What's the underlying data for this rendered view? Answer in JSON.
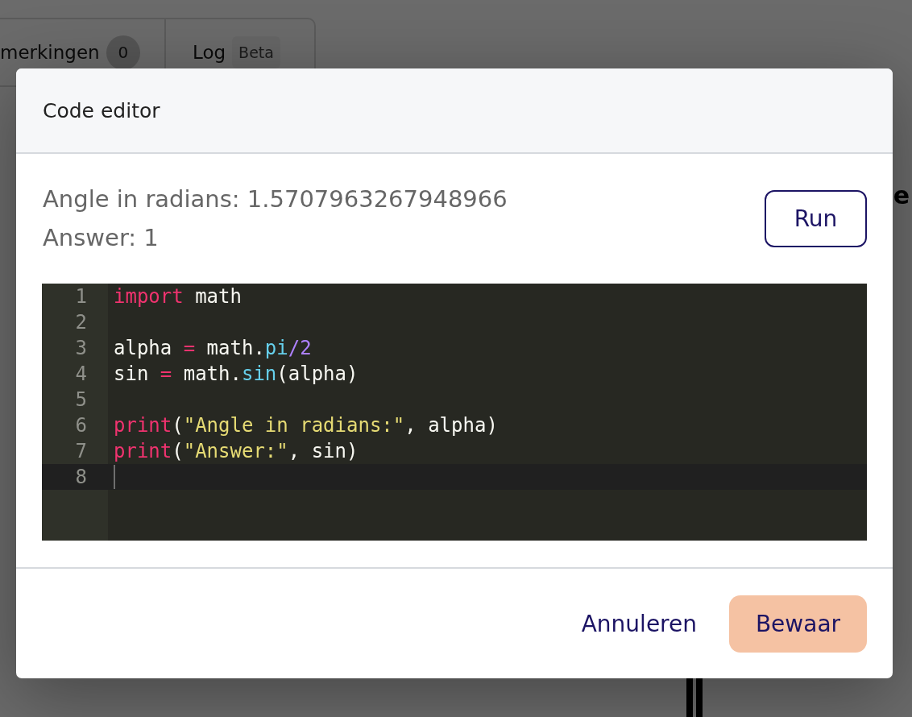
{
  "background_page": {
    "tabs": [
      {
        "label": "merkingen",
        "badge": "0",
        "kind": "count"
      },
      {
        "label": "Log",
        "badge": "Beta",
        "kind": "tag"
      }
    ],
    "heading_fragment": "e"
  },
  "dialog": {
    "title": "Code editor",
    "output": [
      "Angle in radians: 1.5707963267948966",
      "Answer: 1"
    ],
    "run_button": "Run",
    "editor": {
      "lines": [
        {
          "number": "1",
          "active": false,
          "tokens": [
            {
              "text": "import",
              "kind": "keyword"
            },
            {
              "text": " math",
              "kind": "plain"
            }
          ]
        },
        {
          "number": "2",
          "active": false
        },
        {
          "number": "3",
          "active": false,
          "tokens": [
            {
              "text": "alpha ",
              "kind": "plain"
            },
            {
              "text": "=",
              "kind": "keyword"
            },
            {
              "text": " math.",
              "kind": "plain"
            },
            {
              "text": "pi",
              "kind": "builtin"
            },
            {
              "text": "/2",
              "kind": "number"
            }
          ]
        },
        {
          "number": "4",
          "active": false,
          "tokens": [
            {
              "text": "sin ",
              "kind": "plain"
            },
            {
              "text": "=",
              "kind": "keyword"
            },
            {
              "text": " math.",
              "kind": "plain"
            },
            {
              "text": "sin",
              "kind": "builtin"
            },
            {
              "text": "(alpha)",
              "kind": "plain"
            }
          ]
        },
        {
          "number": "5",
          "active": false
        },
        {
          "number": "6",
          "active": false,
          "tokens": [
            {
              "text": "print",
              "kind": "keyword"
            },
            {
              "text": "(",
              "kind": "plain"
            },
            {
              "text": "\"Angle in radians:\"",
              "kind": "string"
            },
            {
              "text": ", alpha)",
              "kind": "plain"
            }
          ]
        },
        {
          "number": "7",
          "active": false,
          "tokens": [
            {
              "text": "print",
              "kind": "keyword"
            },
            {
              "text": "(",
              "kind": "plain"
            },
            {
              "text": "\"Answer:\"",
              "kind": "string"
            },
            {
              "text": ", sin)",
              "kind": "plain"
            }
          ]
        },
        {
          "number": "8",
          "active": true
        }
      ]
    },
    "buttons": [
      {
        "label": "Annuleren",
        "kind": "secondary"
      },
      {
        "label": "Bewaar",
        "kind": "primary"
      }
    ]
  }
}
